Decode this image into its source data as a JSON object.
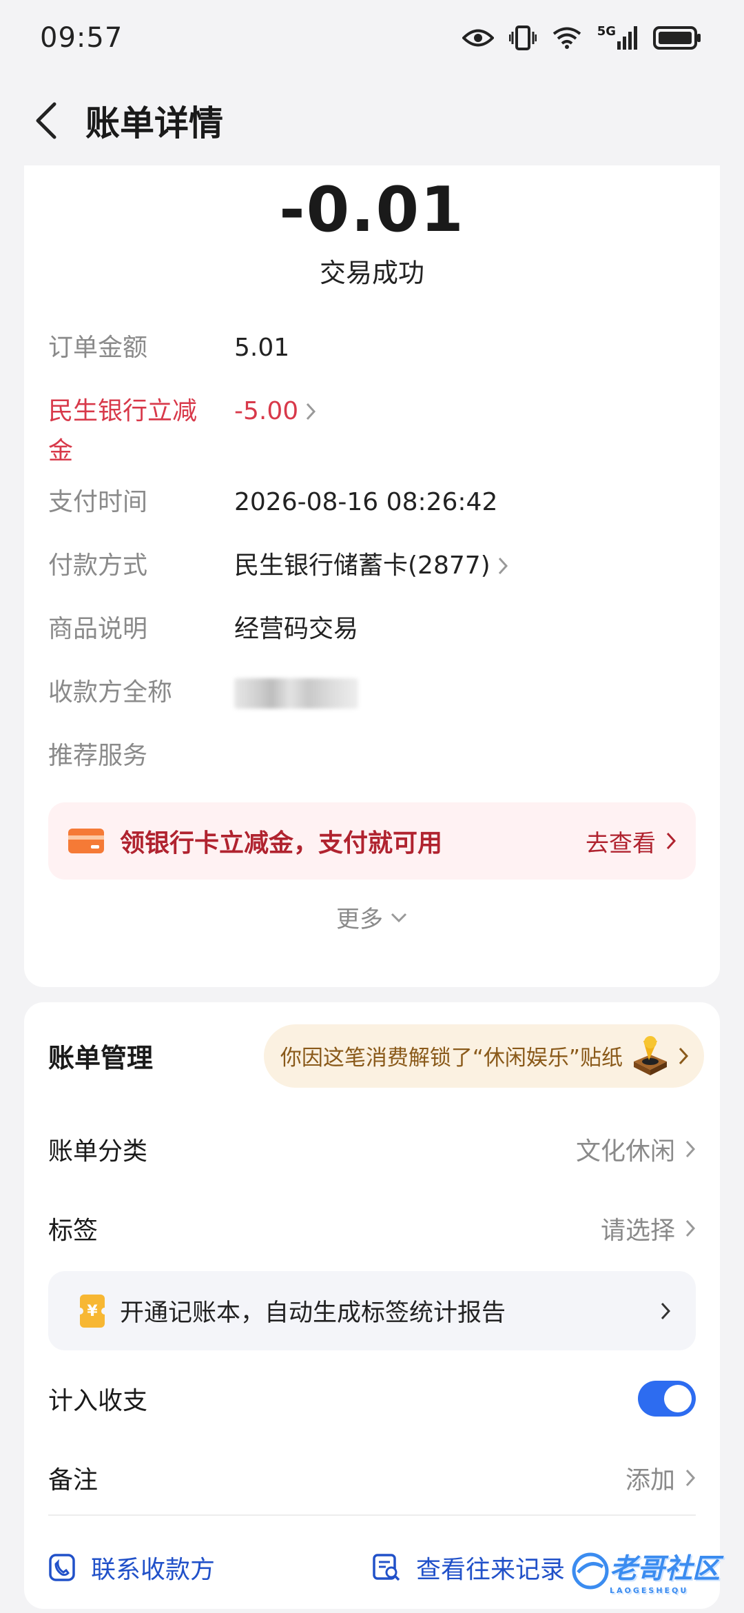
{
  "status_bar": {
    "time": "09:57",
    "network": "5G"
  },
  "nav": {
    "title": "账单详情"
  },
  "summary": {
    "amount": "-0.01",
    "status": "交易成功"
  },
  "details": [
    {
      "label": "订单金额",
      "value": "5.01"
    },
    {
      "label": "民生银行立减金",
      "value": "-5.00"
    },
    {
      "label": "支付时间",
      "value": "2026-08-16 08:26:42"
    },
    {
      "label": "付款方式",
      "value": "民生银行储蓄卡(2877)"
    },
    {
      "label": "商品说明",
      "value": "经营码交易"
    },
    {
      "label": "收款方全称"
    },
    {
      "label": "推荐服务"
    }
  ],
  "promo": {
    "text": "领银行卡立减金，支付就可用",
    "link": "去查看"
  },
  "more": {
    "label": "更多"
  },
  "management": {
    "title": "账单管理",
    "sticker_text": "你因这笔消费解锁了“休闲娱乐”贴纸",
    "category_label": "账单分类",
    "category_value": "文化休闲",
    "tag_label": "标签",
    "tag_value": "请选择",
    "ledger_text": "开通记账本，自动生成标签统计报告",
    "income_label": "计入收支",
    "income_enabled": true,
    "note_label": "备注",
    "note_value": "添加"
  },
  "actions": {
    "contact": "联系收款方",
    "history": "查看往来记录"
  },
  "watermark": {
    "text": "老哥社区",
    "sub": "LAOGESHEQU"
  },
  "colors": {
    "accent_blue": "#2d6cf0",
    "discount_red": "#d8394a",
    "promo_bg": "#fff2f3",
    "sticker_bg": "#fbf1e1"
  }
}
